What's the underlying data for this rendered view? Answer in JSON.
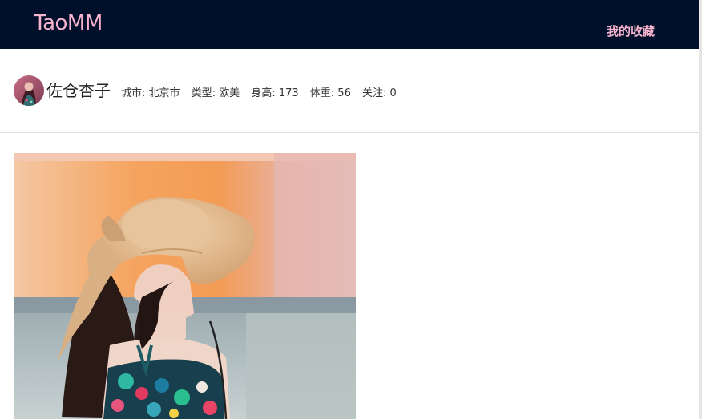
{
  "nav": {
    "brand": "TaoMM",
    "favorites": "我的收藏"
  },
  "profile": {
    "name": "佐仓杏子",
    "city": "城市: 北京市",
    "type": "类型: 欧美",
    "height": "身高: 173",
    "weight": "体重: 56",
    "follow": "关注: 0"
  },
  "colors": {
    "navbar_bg": "#00102a",
    "nav_text": "#f8b3ce"
  }
}
